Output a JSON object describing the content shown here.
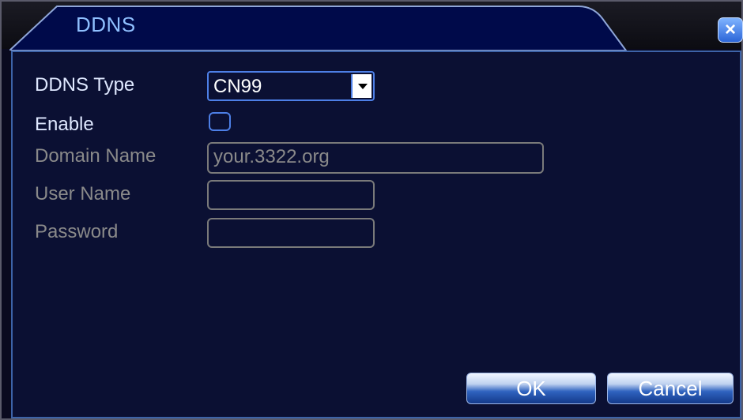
{
  "window": {
    "title": "DDNS",
    "close_glyph": "×"
  },
  "form": {
    "ddns_type_label": "DDNS Type",
    "ddns_type_value": "CN99",
    "enable_label": "Enable",
    "enable_checked": false,
    "domain_name_label": "Domain Name",
    "domain_name_value": "your.3322.org",
    "user_name_label": "User Name",
    "user_name_value": "",
    "password_label": "Password",
    "password_value": ""
  },
  "buttons": {
    "ok_label": "OK",
    "cancel_label": "Cancel"
  },
  "colors": {
    "title": "#8fc0ff",
    "panel_background": "#0b1033",
    "panel_border": "#3d63a8",
    "active_control_border": "#4d7fe6",
    "disabled_text": "#8a8a8a"
  }
}
